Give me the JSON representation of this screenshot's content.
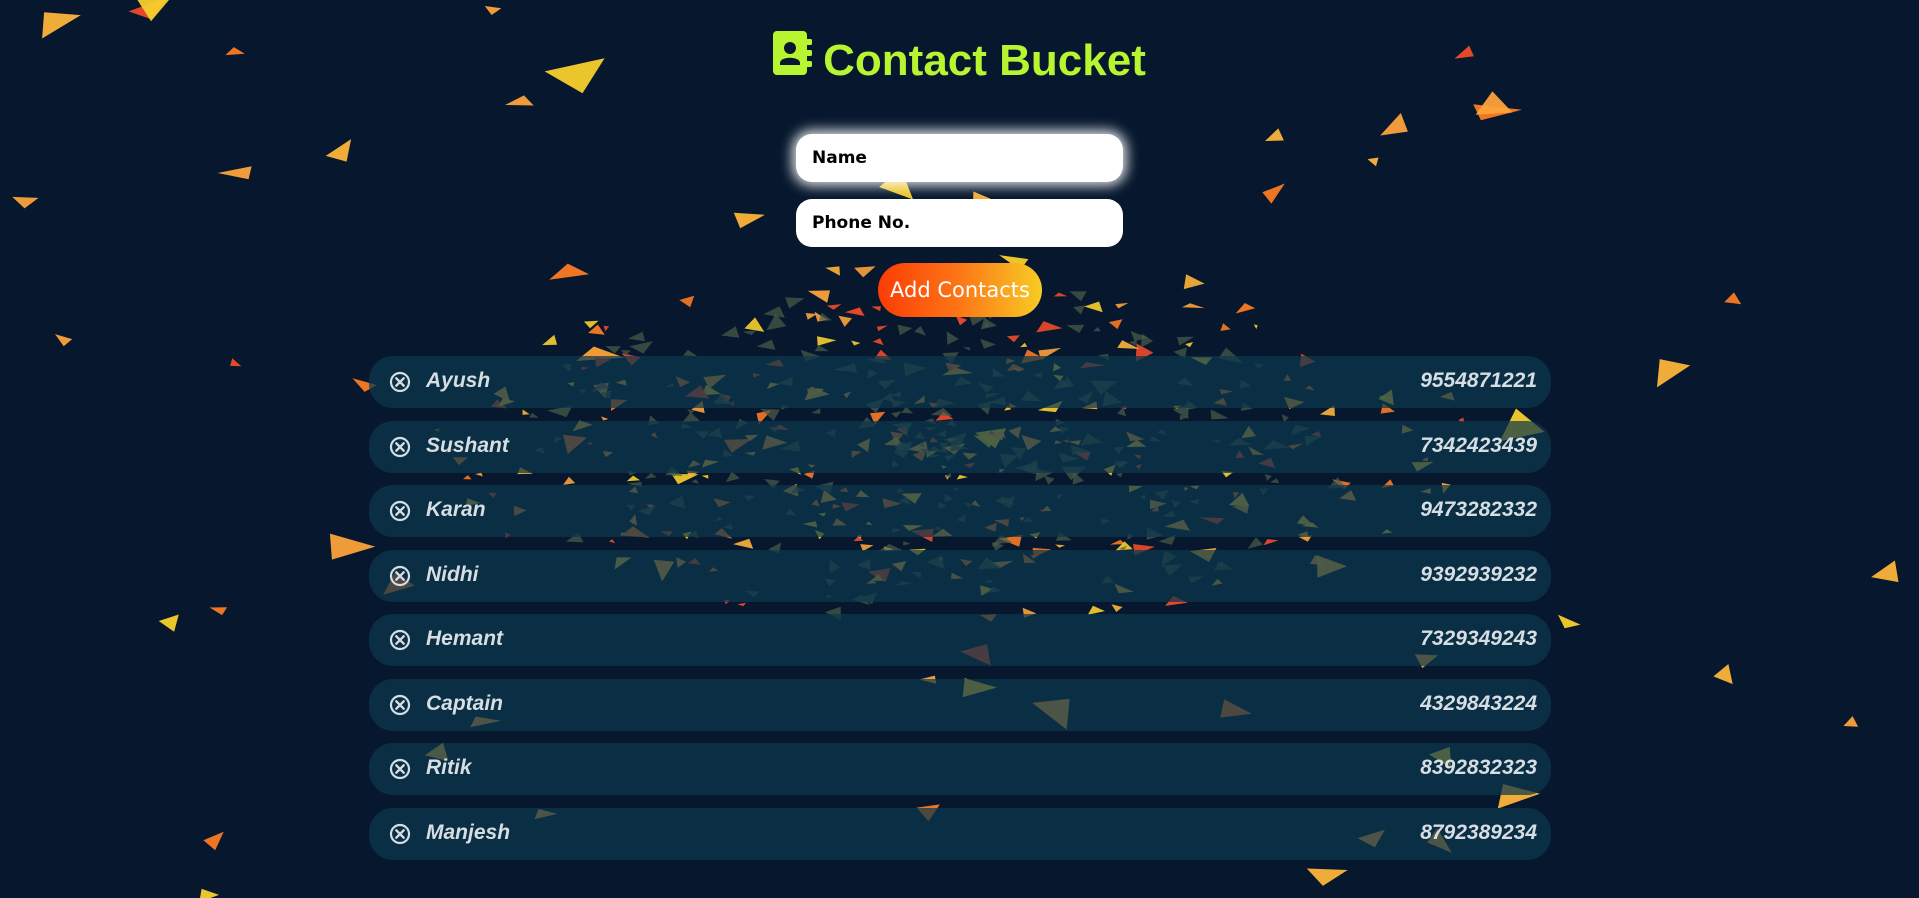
{
  "header": {
    "title": "Contact Bucket",
    "icon": "contact-book-icon",
    "title_color": "#b7f531"
  },
  "form": {
    "name_placeholder": "Name",
    "name_value": "",
    "phone_placeholder": "Phone No.",
    "phone_value": "",
    "add_label": "Add Contacts"
  },
  "contacts": [
    {
      "name": "Ayush",
      "phone": "9554871221"
    },
    {
      "name": "Sushant",
      "phone": "7342423439"
    },
    {
      "name": "Karan",
      "phone": "9473282332"
    },
    {
      "name": "Nidhi",
      "phone": "9392939232"
    },
    {
      "name": "Hemant",
      "phone": "7329349243"
    },
    {
      "name": "Captain",
      "phone": "4329843224"
    },
    {
      "name": "Ritik",
      "phone": "8392832323"
    },
    {
      "name": "Manjesh",
      "phone": "8792389234"
    }
  ],
  "colors": {
    "background": "#07182e",
    "row_background": "#0c384c",
    "button_gradient": [
      "#fb3c06",
      "#f8cc25"
    ],
    "text": "#d6dde3"
  }
}
